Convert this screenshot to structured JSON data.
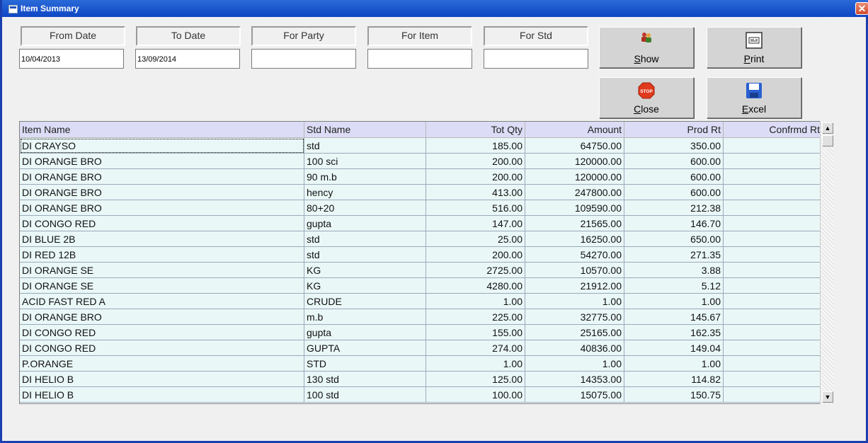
{
  "window": {
    "title": "Item Summary",
    "close_glyph": "✕"
  },
  "filters": [
    {
      "label": "From Date",
      "value": "10/04/2013"
    },
    {
      "label": "To Date",
      "value": "13/09/2014"
    },
    {
      "label": "For Party",
      "value": ""
    },
    {
      "label": "For Item",
      "value": ""
    },
    {
      "label": "For Std",
      "value": ""
    }
  ],
  "buttons": {
    "show": {
      "label_mnemonic": "S",
      "label_rest": "how",
      "icon": "users-icon"
    },
    "print": {
      "label_mnemonic": "P",
      "label_rest": "rint",
      "icon": "printer-icon"
    },
    "close": {
      "label_mnemonic": "C",
      "label_rest": "lose",
      "icon": "stop-sign-icon",
      "icon_text": "STOP"
    },
    "excel": {
      "label_mnemonic": "E",
      "label_rest": "xcel",
      "icon": "save-disk-icon"
    }
  },
  "grid": {
    "columns": [
      "Item Name",
      "Std Name",
      "Tot Qty",
      "Amount",
      "Prod Rt",
      "Confrmd Rt"
    ],
    "rows": [
      [
        "DI CRAYSO",
        "std",
        "185.00",
        "64750.00",
        "350.00",
        ""
      ],
      [
        "DI ORANGE BRO",
        "100 sci",
        "200.00",
        "120000.00",
        "600.00",
        ""
      ],
      [
        "DI ORANGE BRO",
        "90 m.b",
        "200.00",
        "120000.00",
        "600.00",
        ""
      ],
      [
        "DI ORANGE BRO",
        "hency",
        "413.00",
        "247800.00",
        "600.00",
        ""
      ],
      [
        "DI ORANGE BRO",
        "80+20",
        "516.00",
        "109590.00",
        "212.38",
        ""
      ],
      [
        "DI CONGO RED",
        "gupta",
        "147.00",
        "21565.00",
        "146.70",
        ""
      ],
      [
        "DI BLUE 2B",
        "std",
        "25.00",
        "16250.00",
        "650.00",
        ""
      ],
      [
        "DI RED 12B",
        "std",
        "200.00",
        "54270.00",
        "271.35",
        ""
      ],
      [
        "DI ORANGE SE",
        "KG",
        "2725.00",
        "10570.00",
        "3.88",
        ""
      ],
      [
        "DI ORANGE SE",
        "KG",
        "4280.00",
        "21912.00",
        "5.12",
        ""
      ],
      [
        "ACID FAST RED A",
        "CRUDE",
        "1.00",
        "1.00",
        "1.00",
        ""
      ],
      [
        "DI ORANGE BRO",
        "m.b",
        "225.00",
        "32775.00",
        "145.67",
        ""
      ],
      [
        "DI CONGO RED",
        "gupta",
        "155.00",
        "25165.00",
        "162.35",
        ""
      ],
      [
        "DI CONGO RED",
        "GUPTA",
        "274.00",
        "40836.00",
        "149.04",
        ""
      ],
      [
        "P.ORANGE",
        "STD",
        "1.00",
        "1.00",
        "1.00",
        ""
      ],
      [
        "DI HELIO B",
        "130 std",
        "125.00",
        "14353.00",
        "114.82",
        ""
      ],
      [
        "DI HELIO B",
        "100 std",
        "100.00",
        "15075.00",
        "150.75",
        ""
      ]
    ]
  }
}
